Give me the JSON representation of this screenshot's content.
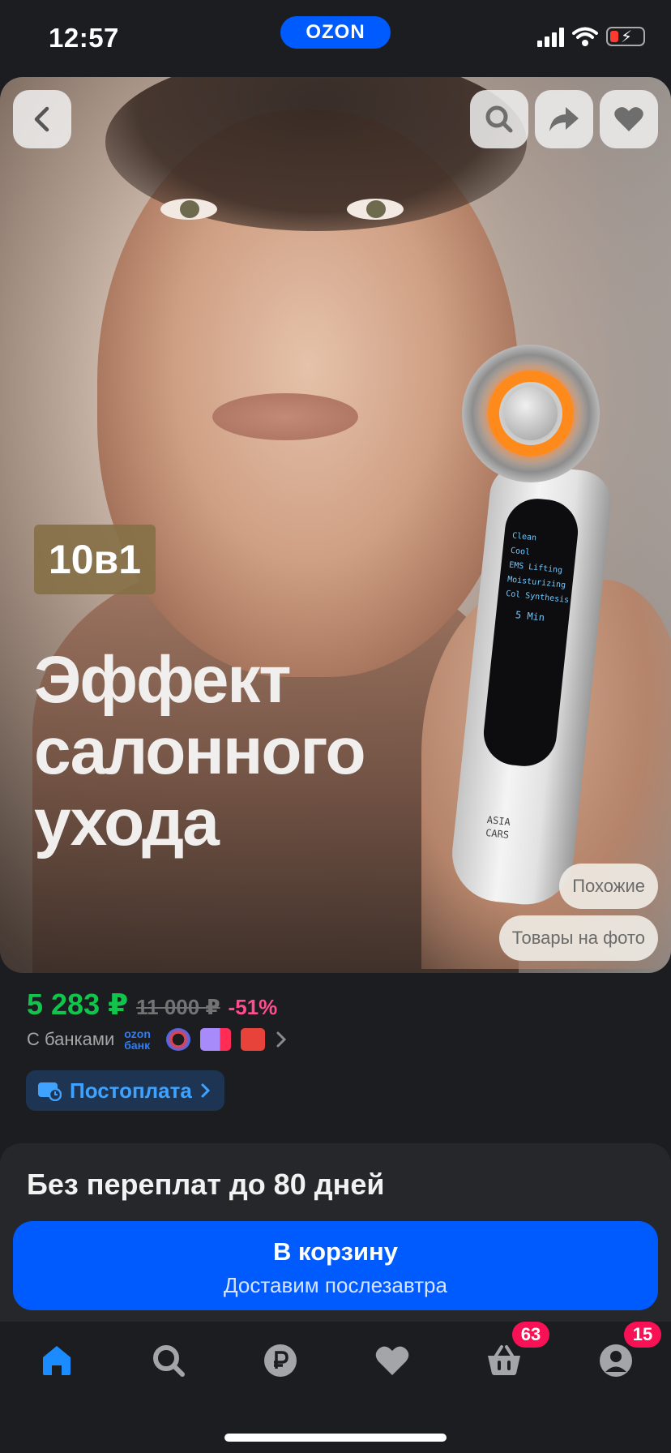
{
  "status_bar": {
    "time": "12:57",
    "brand": "OZON"
  },
  "hero": {
    "badge": "10в1",
    "promo_lines": [
      "Эффект",
      "салонного",
      "ухода"
    ],
    "device_labels": [
      "Clean",
      "Cool",
      "EMS Lifting",
      "Moisturizing",
      "Col Synthesis",
      "5 Min"
    ],
    "device_brand": "ASIA CARS",
    "chip_similar": "Похожие",
    "chip_in_photo": "Товары на фото"
  },
  "price": {
    "current": "5 283 ₽",
    "old": "11 000 ₽",
    "discount": "-51%",
    "banks_label": "С банками",
    "ozon_bank": "ozon банк",
    "postpay": "Постоплата"
  },
  "info_card": {
    "title": "Без переплат до 80 дней"
  },
  "cart": {
    "label": "В корзину",
    "sublabel": "Доставим послезавтра"
  },
  "tabbar": {
    "cart_count": "63",
    "profile_count": "15"
  },
  "colors": {
    "brand": "#005bff",
    "price": "#10c44c",
    "discount": "#ff4d8d",
    "badge": "#f91155"
  }
}
